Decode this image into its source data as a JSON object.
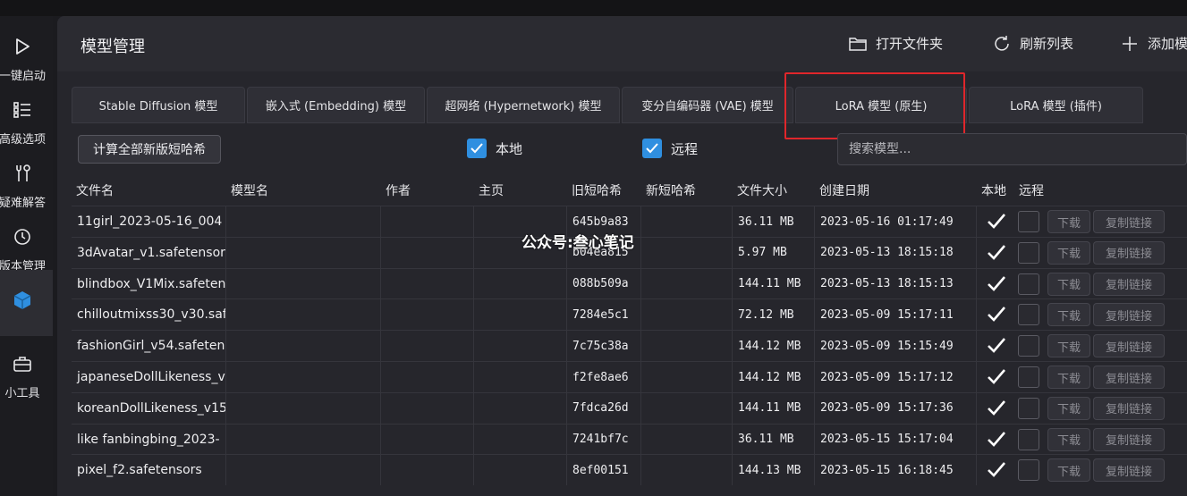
{
  "sidebar": {
    "items": [
      {
        "label": "一键启动",
        "icon": "play-icon"
      },
      {
        "label": "高级选项",
        "icon": "list-icon"
      },
      {
        "label": "疑难解答",
        "icon": "tools-icon"
      },
      {
        "label": "版本管理",
        "icon": "history-icon"
      },
      {
        "label": "",
        "icon": "cube-icon"
      },
      {
        "label": "小工具",
        "icon": "toolbox-icon"
      }
    ]
  },
  "header": {
    "title": "模型管理",
    "open_folder": "打开文件夹",
    "refresh": "刷新列表",
    "add": "添加模"
  },
  "tabs": [
    "Stable Diffusion 模型",
    "嵌入式 (Embedding) 模型",
    "超网络 (Hypernetwork) 模型",
    "变分自编码器 (VAE) 模型",
    "LoRA 模型 (原生)",
    "LoRA 模型 (插件)"
  ],
  "toolbar": {
    "calc_button": "计算全部新版短哈希",
    "local_label": "本地",
    "remote_label": "远程",
    "search_placeholder": "搜索模型..."
  },
  "table": {
    "headers": [
      "文件名",
      "模型名",
      "作者",
      "主页",
      "旧短哈希",
      "新短哈希",
      "文件大小",
      "创建日期",
      "本地",
      "远程"
    ],
    "download_label": "下载",
    "copy_label": "复制链接",
    "rows": [
      {
        "file": "11girl_2023-05-16_004",
        "old_hash": "645b9a83",
        "size": "36.11 MB",
        "date": "2023-05-16 01:17:49"
      },
      {
        "file": "3dAvatar_v1.safetensor",
        "old_hash": "b04ea815",
        "size": "5.97 MB",
        "date": "2023-05-13 18:15:18"
      },
      {
        "file": "blindbox_V1Mix.safeten",
        "old_hash": "088b509a",
        "size": "144.11 MB",
        "date": "2023-05-13 18:15:13"
      },
      {
        "file": "chilloutmixss30_v30.saf",
        "old_hash": "7284e5c1",
        "size": "72.12 MB",
        "date": "2023-05-09 15:17:11"
      },
      {
        "file": "fashionGirl_v54.safeten",
        "old_hash": "7c75c38a",
        "size": "144.12 MB",
        "date": "2023-05-09 15:15:49"
      },
      {
        "file": "japaneseDollLikeness_v",
        "old_hash": "f2fe8ae6",
        "size": "144.12 MB",
        "date": "2023-05-09 15:17:12"
      },
      {
        "file": "koreanDollLikeness_v15",
        "old_hash": "7fdca26d",
        "size": "144.11 MB",
        "date": "2023-05-09 15:17:36"
      },
      {
        "file": "like fanbingbing_2023-",
        "old_hash": "7241bf7c",
        "size": "36.11 MB",
        "date": "2023-05-15 15:17:04"
      },
      {
        "file": "pixel_f2.safetensors",
        "old_hash": "8ef00151",
        "size": "144.13 MB",
        "date": "2023-05-15 16:18:45"
      }
    ]
  },
  "watermark": "公众号:叁心笔记",
  "colors": {
    "accent": "#2f8fe0",
    "highlight": "#e0262b"
  }
}
